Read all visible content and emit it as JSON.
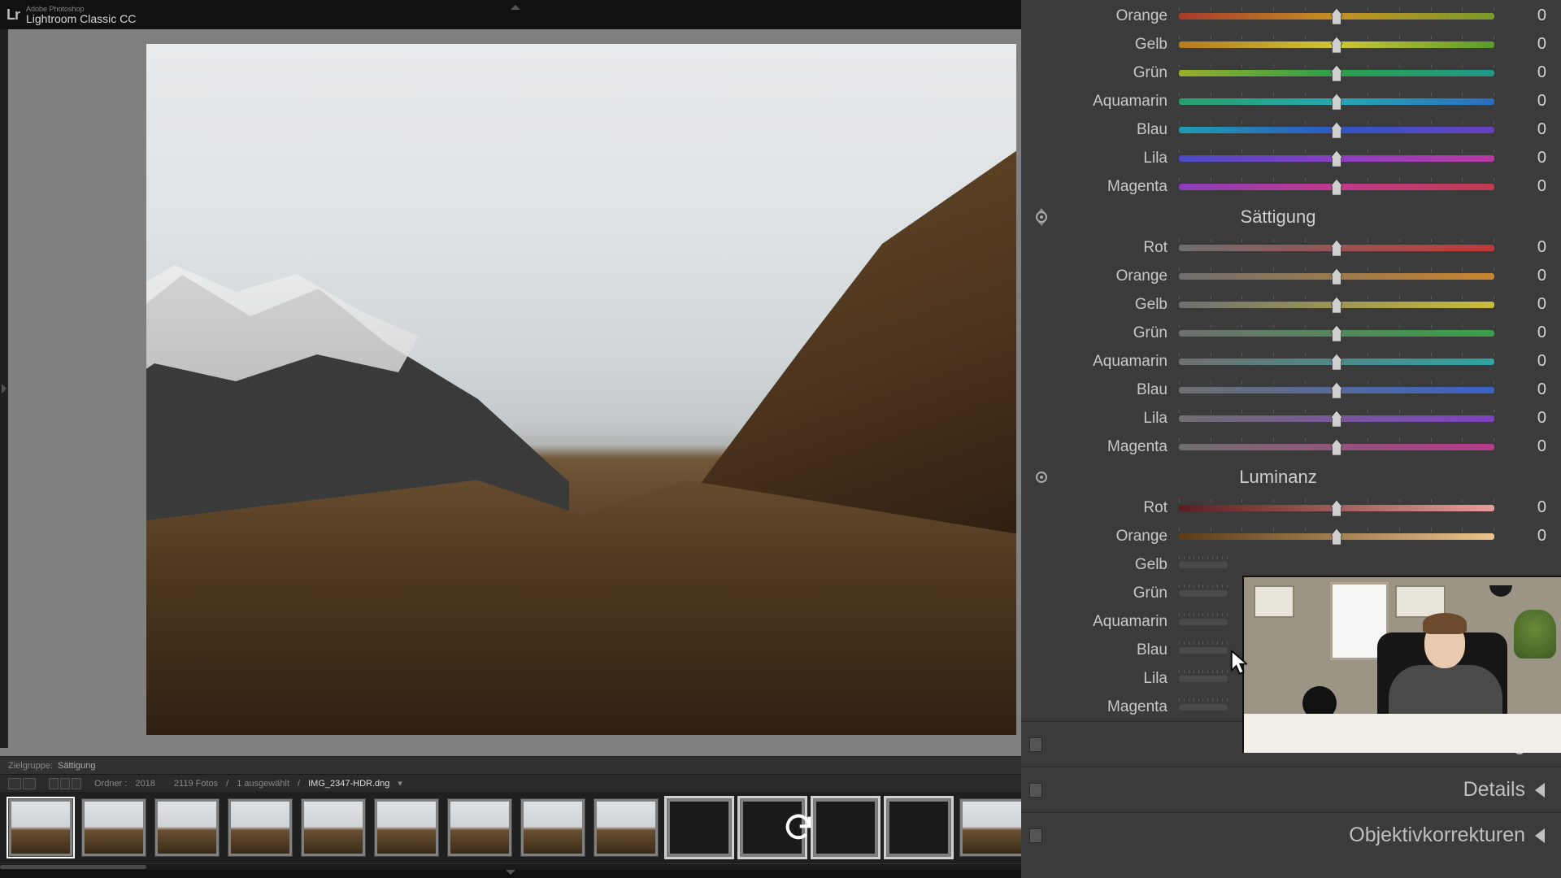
{
  "app": {
    "logo": "Lr",
    "subbrand": "Adobe Photoshop",
    "product": "Lightroom Classic CC"
  },
  "info": {
    "group_label": "Zielgruppe:",
    "group_value": "Sättigung"
  },
  "filmstrip_header": {
    "folder_label": "Ordner :",
    "folder": "2018",
    "count": "2119 Fotos",
    "selected": "1 ausgewählt",
    "file": "IMG_2347-HDR.dng",
    "menu_marker": "▾"
  },
  "panels": {
    "hue": {
      "sliders": [
        {
          "label": "Orange",
          "value": "0",
          "grad": "g-hue-orange"
        },
        {
          "label": "Gelb",
          "value": "0",
          "grad": "g-hue-gelb"
        },
        {
          "label": "Grün",
          "value": "0",
          "grad": "g-hue-gruen"
        },
        {
          "label": "Aquamarin",
          "value": "0",
          "grad": "g-hue-aqua"
        },
        {
          "label": "Blau",
          "value": "0",
          "grad": "g-hue-blau"
        },
        {
          "label": "Lila",
          "value": "0",
          "grad": "g-hue-lila"
        },
        {
          "label": "Magenta",
          "value": "0",
          "grad": "g-hue-mag"
        }
      ]
    },
    "sat": {
      "title": "Sättigung",
      "sliders": [
        {
          "label": "Rot",
          "value": "0",
          "grad": "g-sat-rot"
        },
        {
          "label": "Orange",
          "value": "0",
          "grad": "g-sat-orange"
        },
        {
          "label": "Gelb",
          "value": "0",
          "grad": "g-sat-gelb"
        },
        {
          "label": "Grün",
          "value": "0",
          "grad": "g-sat-gruen"
        },
        {
          "label": "Aquamarin",
          "value": "0",
          "grad": "g-sat-aqua"
        },
        {
          "label": "Blau",
          "value": "0",
          "grad": "g-sat-blau"
        },
        {
          "label": "Lila",
          "value": "0",
          "grad": "g-sat-lila"
        },
        {
          "label": "Magenta",
          "value": "0",
          "grad": "g-sat-mag"
        }
      ]
    },
    "lum": {
      "title": "Luminanz",
      "sliders": [
        {
          "label": "Rot",
          "value": "0",
          "grad": "g-lum-rot",
          "covered": false
        },
        {
          "label": "Orange",
          "value": "0",
          "grad": "g-lum-orange",
          "covered": false
        },
        {
          "label": "Gelb",
          "value": "",
          "grad": "g-lum",
          "covered": true
        },
        {
          "label": "Grün",
          "value": "",
          "grad": "g-lum",
          "covered": true
        },
        {
          "label": "Aquamarin",
          "value": "",
          "grad": "g-lum",
          "covered": true
        },
        {
          "label": "Blau",
          "value": "",
          "grad": "g-lum",
          "covered": true
        },
        {
          "label": "Lila",
          "value": "",
          "grad": "g-lum",
          "covered": true
        },
        {
          "label": "Magenta",
          "value": "",
          "grad": "g-lum",
          "covered": true
        }
      ]
    },
    "collapsed": [
      {
        "title": "Teiltonung"
      },
      {
        "title": "Details"
      },
      {
        "title": "Objektivkorrekturen"
      }
    ]
  }
}
